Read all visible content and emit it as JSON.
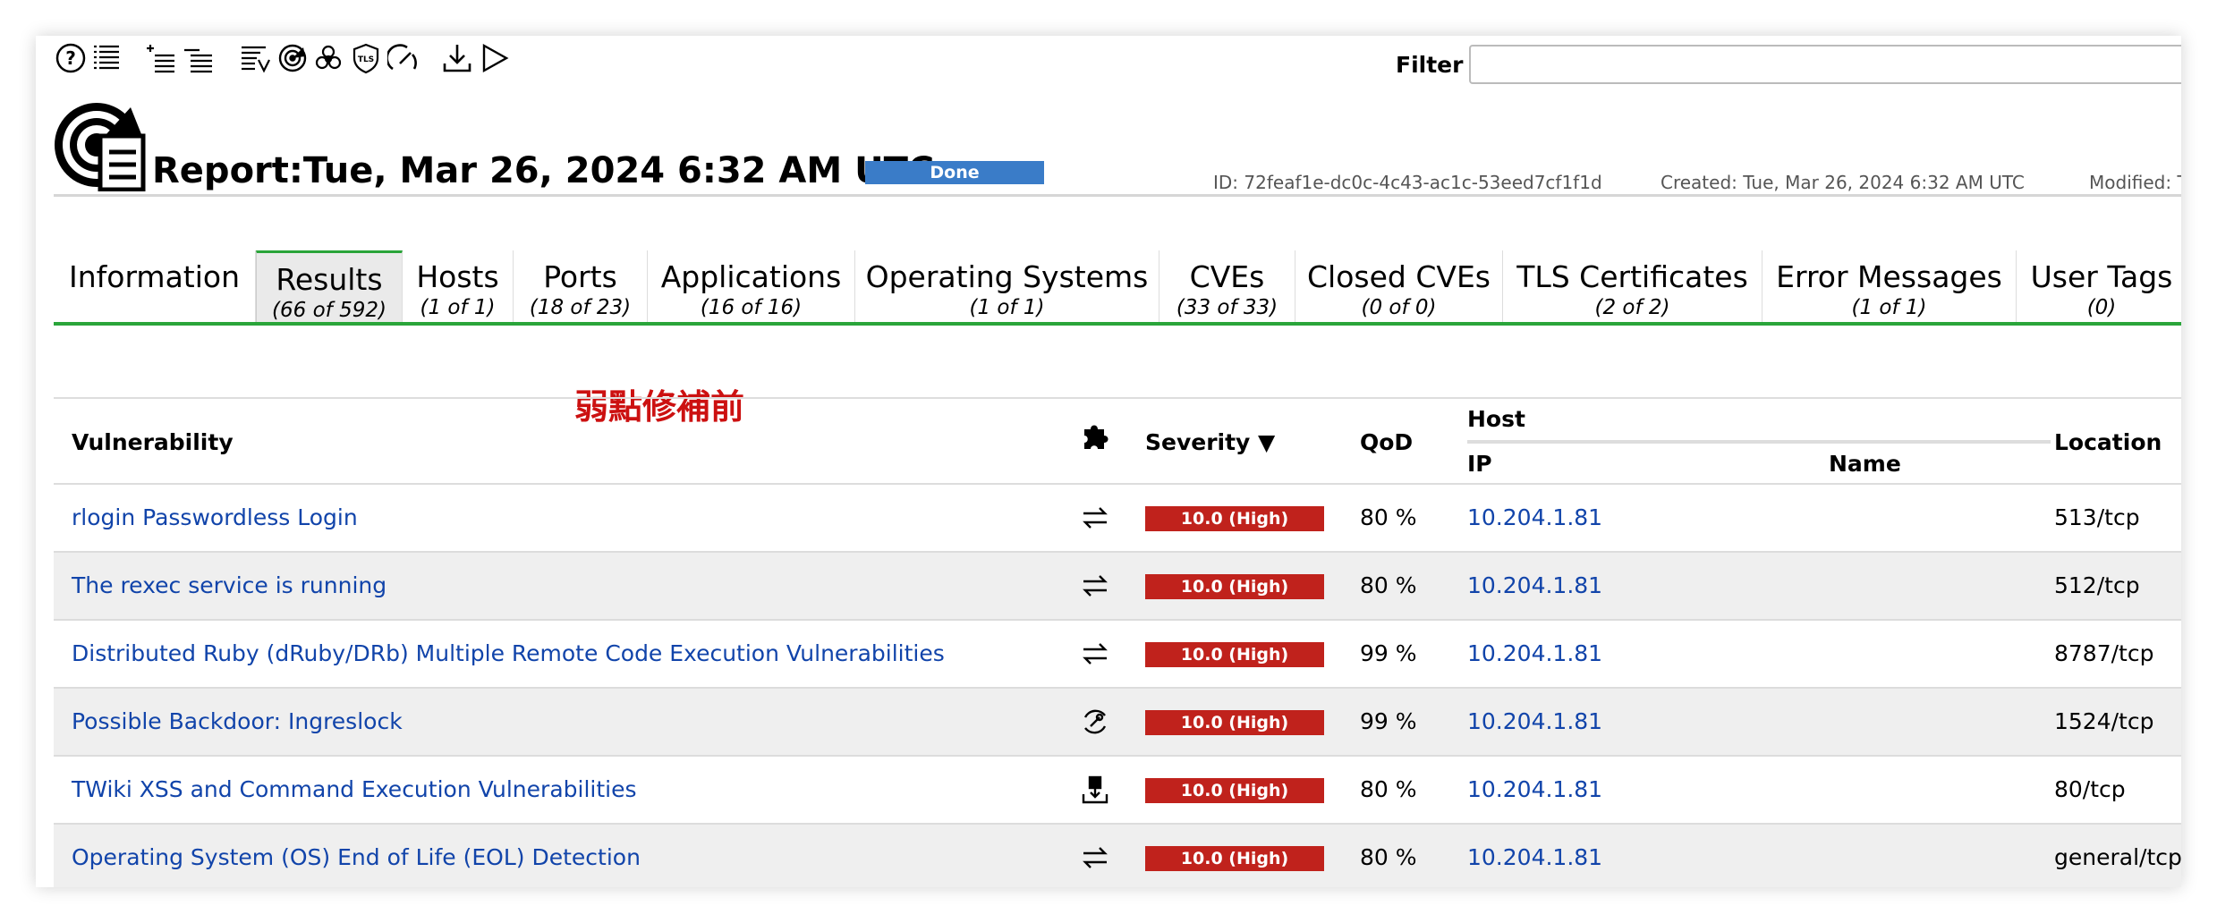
{
  "toolbar": {
    "icons": [
      "help-icon",
      "list-icon",
      "add-list-icon",
      "list-alt-icon",
      "report-list-icon",
      "radar-icon",
      "biohazard-icon",
      "tls-shield-icon",
      "gauge-icon",
      "download-icon",
      "play-icon"
    ],
    "filter_label": "Filter",
    "filter_value": ""
  },
  "header": {
    "title": "Report:Tue, Mar 26, 2024 6:32 AM UTC",
    "status": "Done",
    "id": "ID: 72feaf1e-dc0c-4c43-ac1c-53eed7cf1f1d",
    "created": "Created: Tue, Mar 26, 2024 6:32 AM UTC",
    "modified": "Modified: T"
  },
  "tabs": [
    {
      "label": "Information",
      "count": ""
    },
    {
      "label": "Results",
      "count": "(66 of 592)"
    },
    {
      "label": "Hosts",
      "count": "(1 of 1)"
    },
    {
      "label": "Ports",
      "count": "(18 of 23)"
    },
    {
      "label": "Applications",
      "count": "(16 of 16)"
    },
    {
      "label": "Operating Systems",
      "count": "(1 of 1)"
    },
    {
      "label": "CVEs",
      "count": "(33 of 33)"
    },
    {
      "label": "Closed CVEs",
      "count": "(0 of 0)"
    },
    {
      "label": "TLS Certificates",
      "count": "(2 of 2)"
    },
    {
      "label": "Error Messages",
      "count": "(1 of 1)"
    },
    {
      "label": "User Tags",
      "count": "(0)"
    }
  ],
  "annotation": "弱點修補前",
  "table": {
    "headers": {
      "vulnerability": "Vulnerability",
      "severity": "Severity ▼",
      "qod": "QoD",
      "host": "Host",
      "ip": "IP",
      "name": "Name",
      "location": "Location"
    },
    "rows": [
      {
        "vulnerability": "rlogin Passwordless Login",
        "solution_icon": "mitigate-arrows-icon",
        "severity": "10.0 (High)",
        "qod": "80 %",
        "ip": "10.204.1.81",
        "name": "",
        "location": "513/tcp"
      },
      {
        "vulnerability": "The rexec service is running",
        "solution_icon": "mitigate-arrows-icon",
        "severity": "10.0 (High)",
        "qod": "80 %",
        "ip": "10.204.1.81",
        "name": "",
        "location": "512/tcp"
      },
      {
        "vulnerability": "Distributed Ruby (dRuby/DRb) Multiple Remote Code Execution Vulnerabilities",
        "solution_icon": "mitigate-arrows-icon",
        "severity": "10.0 (High)",
        "qod": "99 %",
        "ip": "10.204.1.81",
        "name": "",
        "location": "8787/tcp"
      },
      {
        "vulnerability": "Possible Backdoor: Ingreslock",
        "solution_icon": "workaround-wrench-icon",
        "severity": "10.0 (High)",
        "qod": "99 %",
        "ip": "10.204.1.81",
        "name": "",
        "location": "1524/tcp"
      },
      {
        "vulnerability": "TWiki XSS and Command Execution Vulnerabilities",
        "solution_icon": "vendorfix-package-icon",
        "severity": "10.0 (High)",
        "qod": "80 %",
        "ip": "10.204.1.81",
        "name": "",
        "location": "80/tcp"
      },
      {
        "vulnerability": "Operating System (OS) End of Life (EOL) Detection",
        "solution_icon": "mitigate-arrows-icon",
        "severity": "10.0 (High)",
        "qod": "80 %",
        "ip": "10.204.1.81",
        "name": "",
        "location": "general/tcp"
      }
    ]
  },
  "colors": {
    "accent_green": "#2aa53a",
    "link_blue": "#1144aa",
    "severity_high": "#c0221c",
    "status_blue": "#3a7cc8",
    "annotation_red": "#cc1111"
  }
}
